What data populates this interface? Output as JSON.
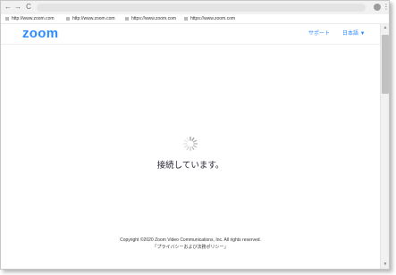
{
  "browser": {
    "back_icon": "back-arrow-icon",
    "forward_icon": "forward-arrow-icon",
    "reload_icon": "reload-icon",
    "menu_icon": "vertical-dots-icon",
    "back_glyph": "←",
    "forward_glyph": "→",
    "reload_glyph": "C",
    "menu_glyph": "⋮",
    "bookmarks": [
      {
        "label": "http://www.zoom.com"
      },
      {
        "label": "http://www.zoom.com"
      },
      {
        "label": "https://www.zoom.com"
      },
      {
        "label": "https://www.zoom.com"
      }
    ]
  },
  "header": {
    "logo": "zoom",
    "support_link": "サポート",
    "language_link": "日本語 ▼"
  },
  "main": {
    "status_text": "接続しています。"
  },
  "footer": {
    "copyright": "Copyright ©2020 Zoom Video Communications, Inc. All rights reserved.",
    "privacy_link": "「プライバシーおよび法務ポリシー」"
  },
  "colors": {
    "brand": "#2d8cff",
    "text": "#232333"
  }
}
